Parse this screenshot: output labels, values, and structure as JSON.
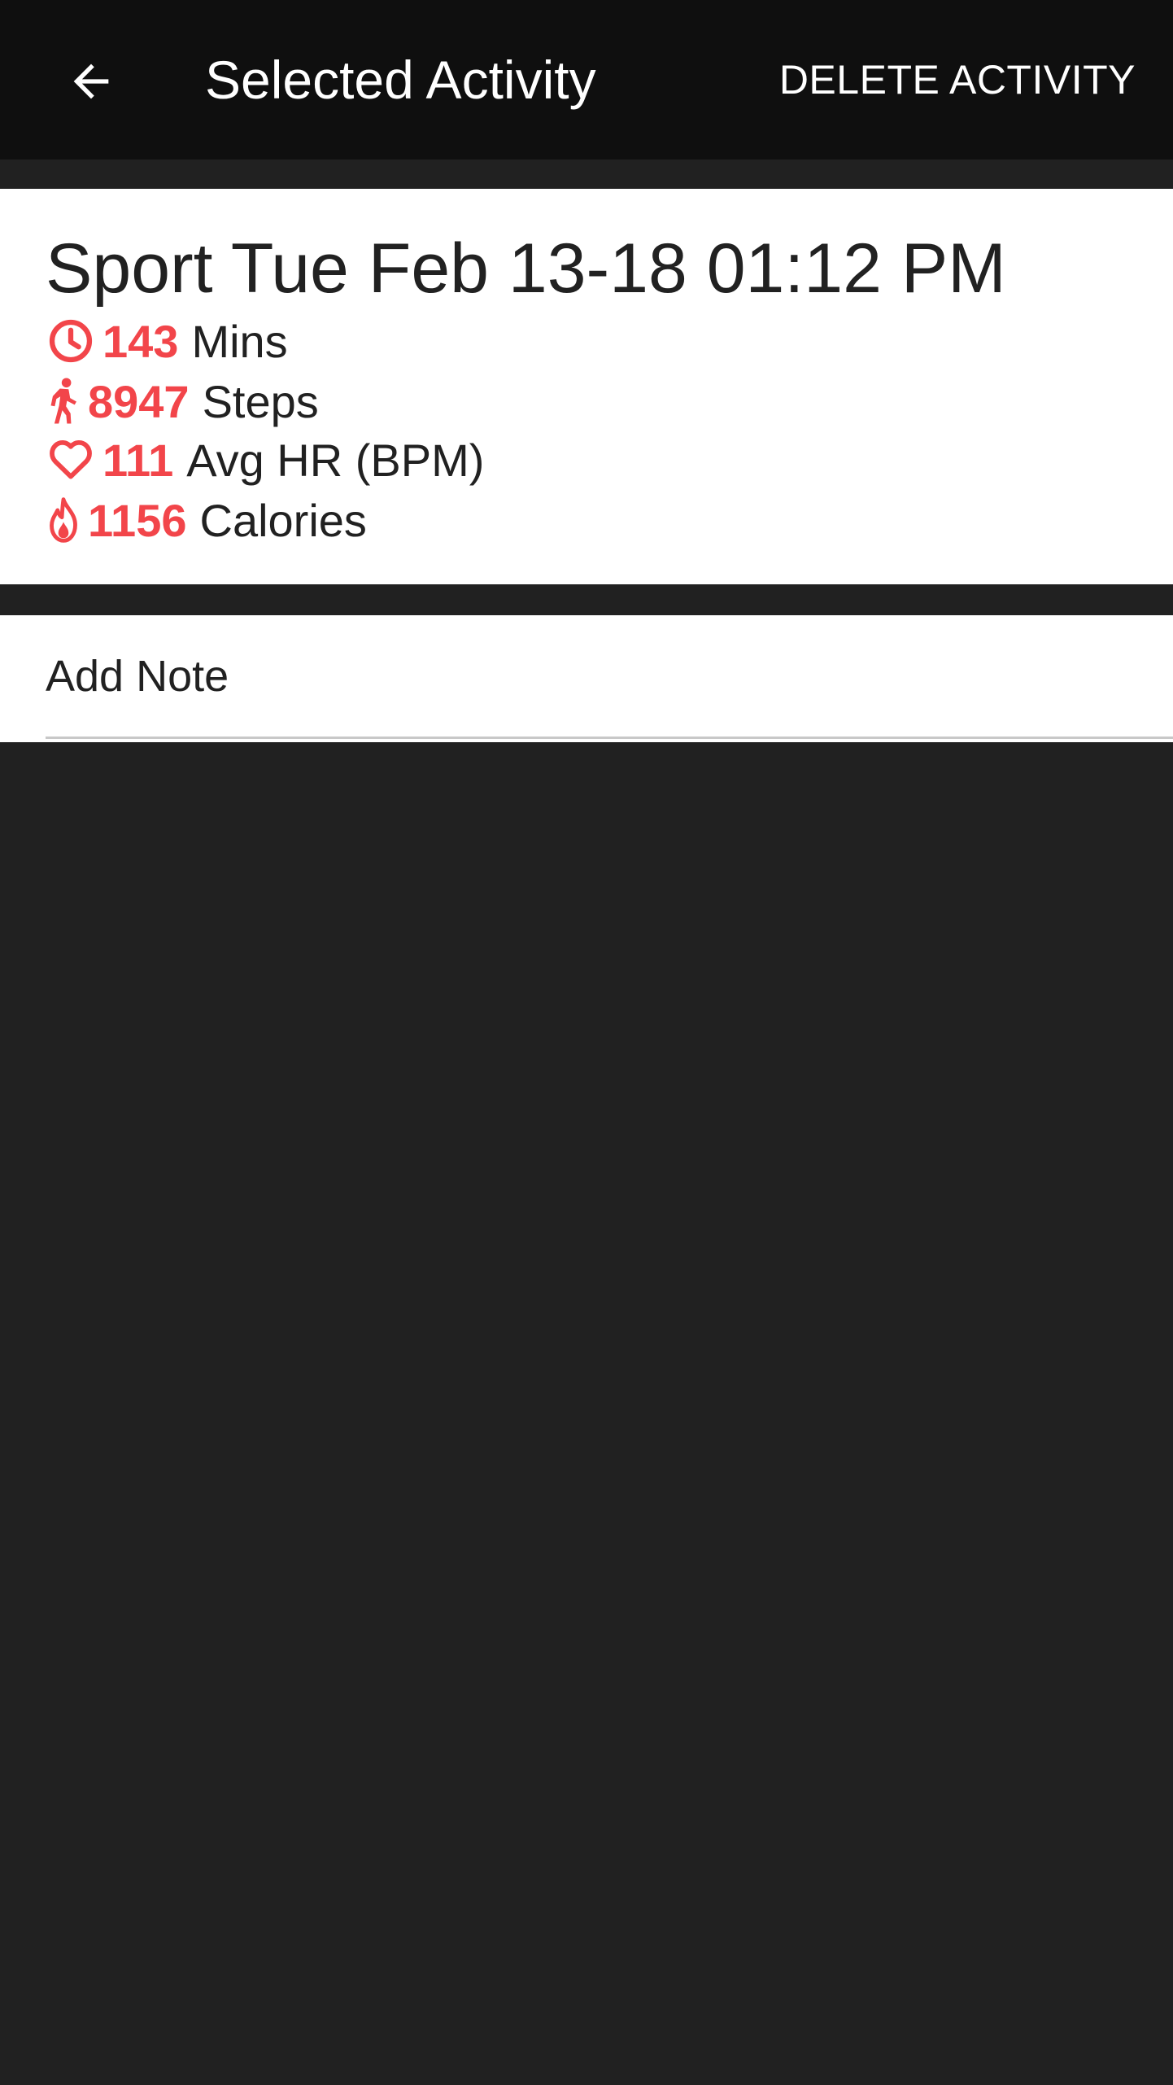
{
  "app_bar": {
    "title": "Selected Activity",
    "delete_label": "DELETE ACTIVITY",
    "back_icon": "arrow-left-icon"
  },
  "activity": {
    "title": "Sport Tue Feb 13-18 01:12 PM",
    "stats": [
      {
        "icon": "clock-icon",
        "value": "143",
        "unit": "Mins"
      },
      {
        "icon": "walking-person-icon",
        "value": "8947",
        "unit": "Steps"
      },
      {
        "icon": "heart-icon",
        "value": "111",
        "unit": "Avg HR (BPM)"
      },
      {
        "icon": "flame-icon",
        "value": "1156",
        "unit": "Calories"
      }
    ]
  },
  "note": {
    "placeholder": "Add Note"
  },
  "colors": {
    "accent": "#f2454a",
    "app_bar_bg": "#0f0f0f",
    "page_bg": "#212121",
    "card_bg": "#ffffff",
    "text_dark": "#212121"
  }
}
